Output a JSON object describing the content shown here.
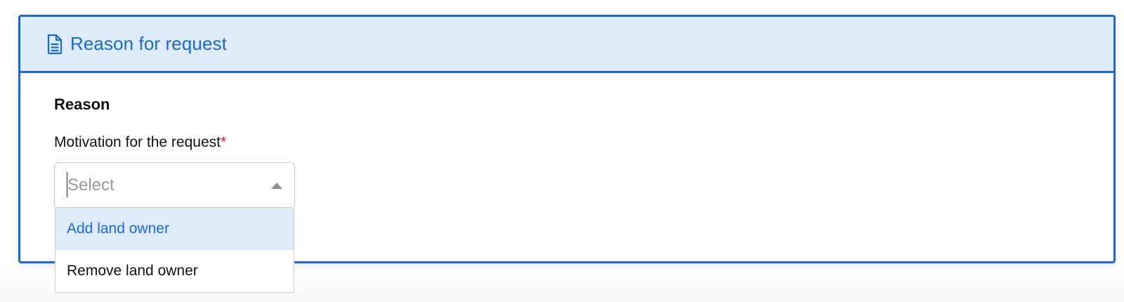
{
  "panel": {
    "title": "Reason for request",
    "icon": "document-icon",
    "accent_color": "#1a6ad1",
    "header_background": "#deebf8"
  },
  "form": {
    "section_heading": "Reason",
    "field_label": "Motivation for the request",
    "required_marker": "*",
    "select": {
      "placeholder": "Select",
      "expanded": true
    },
    "options": [
      {
        "label": "Add land owner",
        "highlighted": true
      },
      {
        "label": "Remove land owner",
        "highlighted": false
      }
    ]
  }
}
